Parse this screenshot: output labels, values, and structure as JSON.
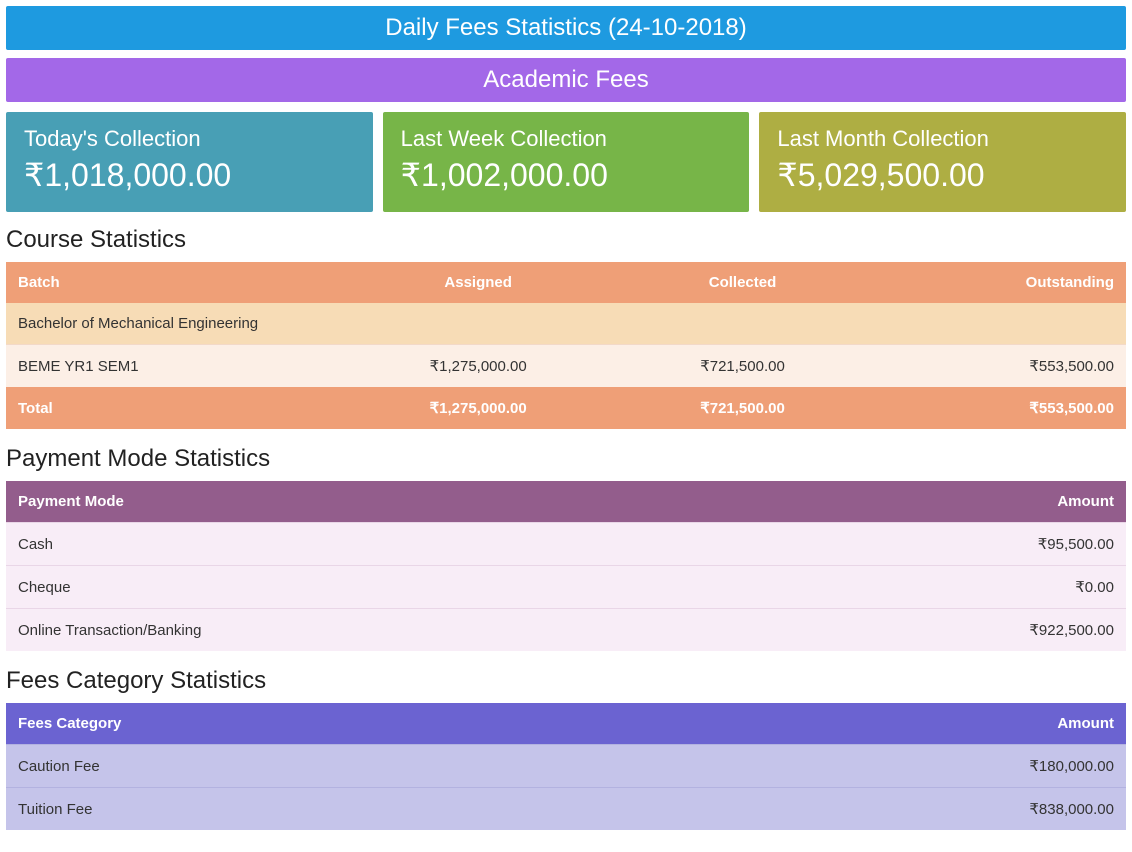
{
  "header": {
    "title": "Daily Fees Statistics (24-10-2018)"
  },
  "subheader": {
    "title": "Academic Fees"
  },
  "cards": {
    "today": {
      "label": "Today's Collection",
      "value": "₹1,018,000.00"
    },
    "lastWeek": {
      "label": "Last Week Collection",
      "value": "₹1,002,000.00"
    },
    "lastMonth": {
      "label": "Last Month Collection",
      "value": "₹5,029,500.00"
    }
  },
  "courseStats": {
    "title": "Course Statistics",
    "headers": {
      "batch": "Batch",
      "assigned": "Assigned",
      "collected": "Collected",
      "outstanding": "Outstanding"
    },
    "groupName": "Bachelor of Mechanical Engineering",
    "row": {
      "batch": "BEME YR1 SEM1",
      "assigned": "₹1,275,000.00",
      "collected": "₹721,500.00",
      "outstanding": "₹553,500.00"
    },
    "total": {
      "label": "Total",
      "assigned": "₹1,275,000.00",
      "collected": "₹721,500.00",
      "outstanding": "₹553,500.00"
    }
  },
  "paymentStats": {
    "title": "Payment Mode Statistics",
    "headers": {
      "mode": "Payment Mode",
      "amount": "Amount"
    },
    "rows": [
      {
        "mode": "Cash",
        "amount": "₹95,500.00"
      },
      {
        "mode": "Cheque",
        "amount": "₹0.00"
      },
      {
        "mode": "Online Transaction/Banking",
        "amount": "₹922,500.00"
      }
    ]
  },
  "categoryStats": {
    "title": "Fees Category Statistics",
    "headers": {
      "category": "Fees Category",
      "amount": "Amount"
    },
    "rows": [
      {
        "category": "Caution Fee",
        "amount": "₹180,000.00"
      },
      {
        "category": "Tuition Fee",
        "amount": "₹838,000.00"
      }
    ]
  }
}
